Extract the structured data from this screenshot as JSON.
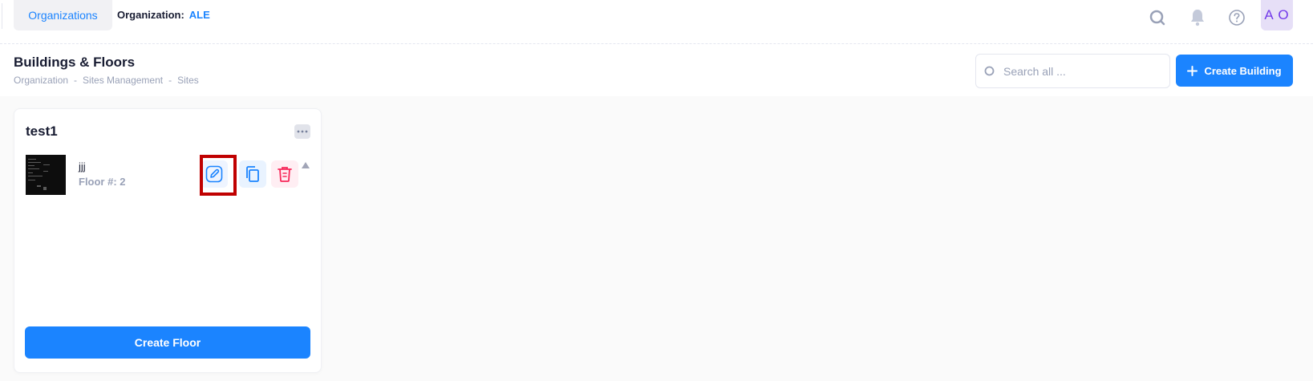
{
  "topbar": {
    "org_tab_label": "Organizations",
    "org_label": "Organization:",
    "org_value": "ALE",
    "avatar_initials": "A O",
    "icons": [
      "search-icon",
      "bell-icon",
      "help-icon"
    ]
  },
  "header": {
    "title": "Buildings & Floors",
    "breadcrumb": [
      "Organization",
      "Sites Management",
      "Sites"
    ],
    "breadcrumb_sep": "-",
    "search_placeholder": "Search all ...",
    "create_building_label": "Create Building"
  },
  "building": {
    "name": "test1",
    "floors": [
      {
        "name": "jjj",
        "floor_number_label": "Floor #: 2"
      }
    ],
    "create_floor_label": "Create Floor"
  },
  "colors": {
    "primary": "#1b84ff",
    "danger": "#f8285a",
    "highlight": "#c00000",
    "avatar_text": "#7239ea"
  }
}
